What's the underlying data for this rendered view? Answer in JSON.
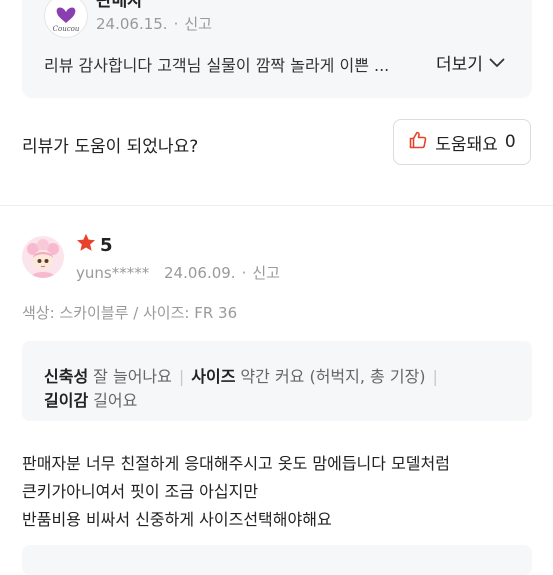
{
  "seller_reply": {
    "name": "판매자",
    "date": "24.06.15.",
    "dot": "·",
    "report_label": "신고",
    "text": "리뷰 감사합니다 고객님 실물이 깜짝 놀라게 이쁜 ...",
    "more_label": "더보기",
    "logo_text": "Coucou"
  },
  "helpful": {
    "question": "리뷰가 도움이 되었나요?",
    "button_label": "도움돼요",
    "count": "0"
  },
  "review": {
    "rating": "5",
    "username": "yuns*****",
    "date": "24.06.09.",
    "dot": "·",
    "report_label": "신고",
    "option": "색상: 스카이블루 / 사이즈: FR 36",
    "attributes": [
      {
        "key": "신축성",
        "value": "잘 늘어나요"
      },
      {
        "key": "사이즈",
        "value": "약간 커요 (허벅지, 총 기장)"
      },
      {
        "key": "길이감",
        "value": "길어요"
      }
    ],
    "body_lines": [
      "판매자분 너무 친절하게 응대해주시고  옷도 맘에듭니다 모델처럼",
      "큰키가아니여서 핏이 조금 아십지만",
      "반품비용 비싸서 신중하게 사이즈선택해야해요"
    ]
  },
  "colors": {
    "star": "#e8412c",
    "thumb": "#e8412c",
    "muted": "#9a9a9a",
    "box_bg": "#f6f7f9"
  }
}
